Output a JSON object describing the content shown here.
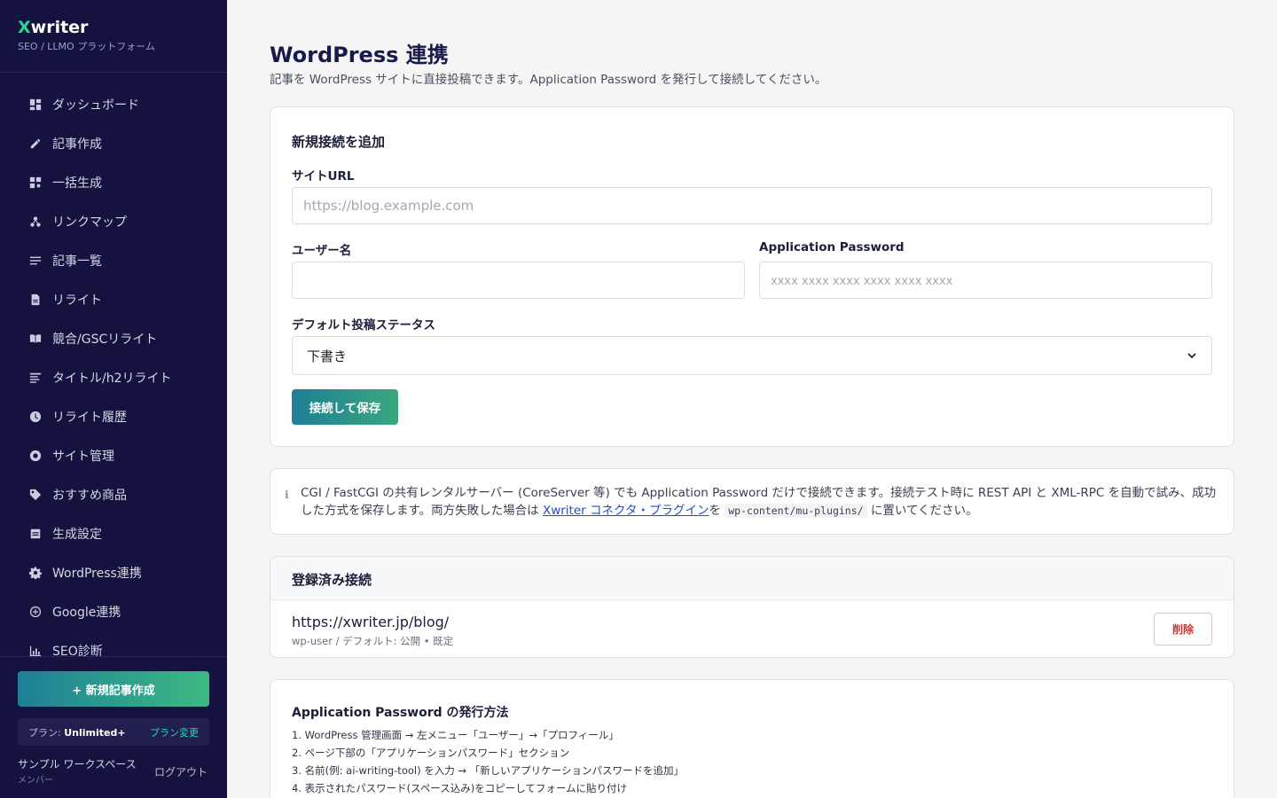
{
  "brand": {
    "x": "X",
    "name": "writer",
    "subtitle": "SEO / LLMO プラットフォーム"
  },
  "nav": [
    {
      "label": "ダッシュボード",
      "icon": "dashboard-icon"
    },
    {
      "label": "記事作成",
      "icon": "pencil-icon"
    },
    {
      "label": "一括生成",
      "icon": "grid-icon"
    },
    {
      "label": "リンクマップ",
      "icon": "link-map-icon"
    },
    {
      "label": "記事一覧",
      "icon": "list-icon"
    },
    {
      "label": "リライト",
      "icon": "document-icon"
    },
    {
      "label": "競合/GSCリライト",
      "icon": "book-icon"
    },
    {
      "label": "タイトル/h2リライト",
      "icon": "title-icon"
    },
    {
      "label": "リライト履歴",
      "icon": "clock-icon"
    },
    {
      "label": "サイト管理",
      "icon": "site-icon"
    },
    {
      "label": "おすすめ商品",
      "icon": "tag-icon"
    },
    {
      "label": "生成設定",
      "icon": "settings-box-icon"
    },
    {
      "label": "WordPress連携",
      "icon": "gear-icon"
    },
    {
      "label": "Google連携",
      "icon": "plus-circle-icon"
    },
    {
      "label": "SEO診断",
      "icon": "chart-icon"
    }
  ],
  "sidebar_footer": {
    "new_article": "+ 新規記事作成",
    "plan_label": "プラン:",
    "plan_value": "Unlimited+",
    "plan_change": "プラン変更",
    "workspace": "サンプル ワークスペース",
    "role": "メンバー",
    "logout": "ログアウト"
  },
  "page": {
    "title": "WordPress 連携",
    "description": "記事を WordPress サイトに直接投稿できます。Application Password を発行して接続してください。"
  },
  "form": {
    "title": "新規接続を追加",
    "site_url_label": "サイトURL",
    "site_url_placeholder": "https://blog.example.com",
    "site_url_value": "",
    "username_label": "ユーザー名",
    "username_value": "",
    "password_label": "Application Password",
    "password_placeholder": "xxxx xxxx xxxx xxxx xxxx xxxx",
    "status_label": "デフォルト投稿ステータス",
    "status_value": "下書き",
    "save_button": "接続して保存"
  },
  "info": {
    "text1": "CGI / FastCGI の共有レンタルサーバー (CoreServer 等) でも Application Password だけで接続できます。接続テスト時に REST API と XML-RPC を自動で試み、成功した方式を保存します。両方失敗した場合は ",
    "link": "Xwriter コネクタ・プラグイン",
    "text2": "を ",
    "code": "wp-content/mu-plugins/",
    "text3": " に置いてください。"
  },
  "connections": {
    "title": "登録済み接続",
    "items": [
      {
        "url": "https://xwriter.jp/blog/",
        "meta": "wp-user / デフォルト: 公開 • 既定",
        "delete": "削除"
      }
    ]
  },
  "howto": {
    "title": "Application Password の発行方法",
    "steps": [
      "1. WordPress 管理画面 → 左メニュー「ユーザー」→「プロフィール」",
      "2. ページ下部の「アプリケーションパスワード」セクション",
      "3. 名前(例: ai-writing-tool) を入力 → 「新しいアプリケーションパスワードを追加」",
      "4. 表示されたパスワード(スペース込み)をコピーしてフォームに貼り付け"
    ]
  },
  "colors": {
    "sidebar_bg": "#14133f",
    "accent_green": "#2fd39a",
    "danger": "#d0312d",
    "link": "#1d4fd6"
  }
}
